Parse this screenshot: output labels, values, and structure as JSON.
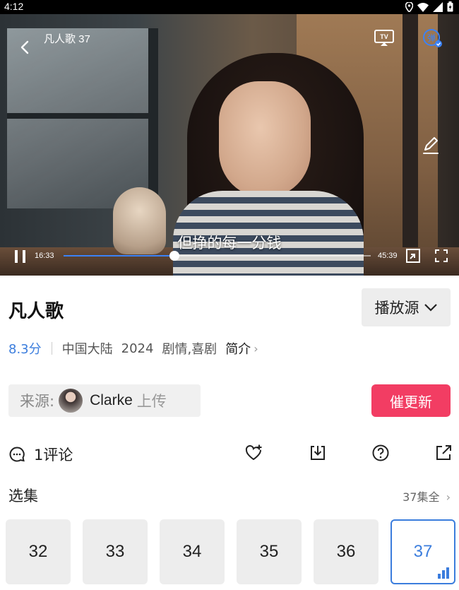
{
  "status_bar": {
    "time": "4:12"
  },
  "player": {
    "episode_title": "凡人歌 37",
    "subtitle": "但挣的每一分钱",
    "time_current": "16:33",
    "time_total": "45:39",
    "progress": 0.36,
    "tv_label": "TV",
    "danmu_label": "弹"
  },
  "show": {
    "title": "凡人歌",
    "source_button": "播放源",
    "score": "8.3分",
    "region": "中国大陆",
    "year": "2024",
    "genre": "剧情,喜剧",
    "intro_label": "简介"
  },
  "uploader": {
    "label": "来源:",
    "name": "Clarke",
    "action": "上传"
  },
  "urge_button": "催更新",
  "actions": {
    "comment_count": "1评论"
  },
  "episodes": {
    "heading": "选集",
    "all_label": "37集全",
    "items": [
      "32",
      "33",
      "34",
      "35",
      "36",
      "37"
    ],
    "current": "37"
  },
  "colors": {
    "accent": "#3b7ddd",
    "urge": "#f23d63"
  }
}
